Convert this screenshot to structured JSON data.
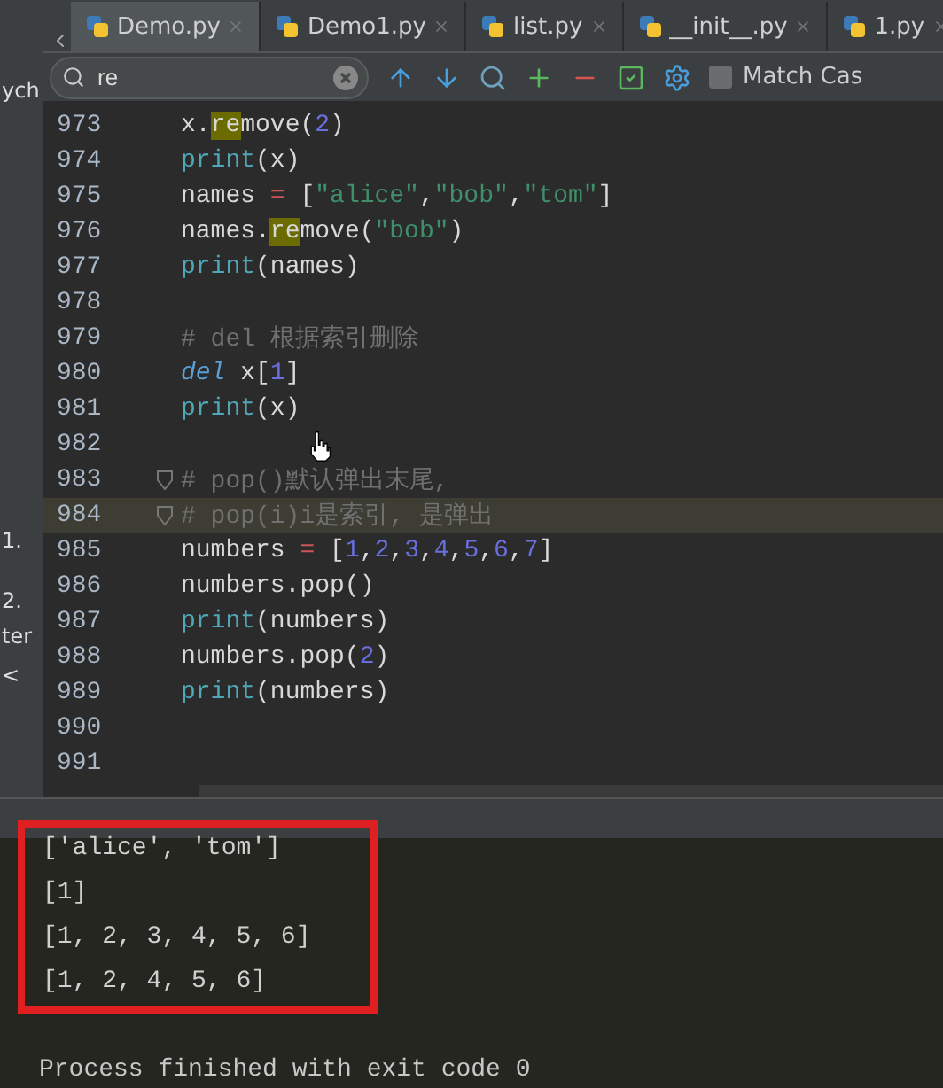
{
  "tabs": [
    {
      "label": "Demo.py",
      "selected": true
    },
    {
      "label": "Demo1.py",
      "selected": false
    },
    {
      "label": "list.py",
      "selected": false
    },
    {
      "label": "__init__.py",
      "selected": false
    },
    {
      "label": "1.py",
      "selected": false
    }
  ],
  "sidebar": {
    "fragments": [
      "ych",
      "1.",
      "2.",
      "ter",
      "<"
    ]
  },
  "search": {
    "value": "re",
    "match_case": {
      "label": "Match Cas",
      "checked": false
    }
  },
  "editor": {
    "lines": [
      {
        "number": "973",
        "current": false,
        "tokens": [
          {
            "kind": "plain",
            "text": "x."
          },
          {
            "kind": "match",
            "text": "re"
          },
          {
            "kind": "plain",
            "text": "move("
          },
          {
            "kind": "number",
            "text": "2"
          },
          {
            "kind": "plain",
            "text": ")"
          }
        ]
      },
      {
        "number": "974",
        "current": false,
        "tokens": [
          {
            "kind": "builtin",
            "text": "print"
          },
          {
            "kind": "plain",
            "text": "(x)"
          }
        ]
      },
      {
        "number": "975",
        "current": false,
        "tokens": [
          {
            "kind": "plain",
            "text": "names "
          },
          {
            "kind": "op",
            "text": "="
          },
          {
            "kind": "plain",
            "text": " ["
          },
          {
            "kind": "string",
            "text": "\"alice\""
          },
          {
            "kind": "plain",
            "text": ","
          },
          {
            "kind": "string",
            "text": "\"bob\""
          },
          {
            "kind": "plain",
            "text": ","
          },
          {
            "kind": "string",
            "text": "\"tom\""
          },
          {
            "kind": "plain",
            "text": "]"
          }
        ]
      },
      {
        "number": "976",
        "current": false,
        "tokens": [
          {
            "kind": "plain",
            "text": "names."
          },
          {
            "kind": "match",
            "text": "re"
          },
          {
            "kind": "plain",
            "text": "move("
          },
          {
            "kind": "string",
            "text": "\"bob\""
          },
          {
            "kind": "plain",
            "text": ")"
          }
        ]
      },
      {
        "number": "977",
        "current": false,
        "tokens": [
          {
            "kind": "builtin",
            "text": "print"
          },
          {
            "kind": "plain",
            "text": "(names)"
          }
        ]
      },
      {
        "number": "978",
        "current": false
      },
      {
        "number": "979",
        "current": false,
        "tokens": [
          {
            "kind": "comment",
            "text": "# del 根据索引删除"
          }
        ]
      },
      {
        "number": "980",
        "current": false,
        "tokens": [
          {
            "kind": "keyword",
            "text": "del"
          },
          {
            "kind": "plain",
            "text": " x["
          },
          {
            "kind": "number",
            "text": "1"
          },
          {
            "kind": "plain",
            "text": "]"
          }
        ]
      },
      {
        "number": "981",
        "current": false,
        "tokens": [
          {
            "kind": "builtin",
            "text": "print"
          },
          {
            "kind": "plain",
            "text": "(x)"
          }
        ]
      },
      {
        "number": "982",
        "current": false
      },
      {
        "number": "983",
        "current": false,
        "fold": true,
        "tokens": [
          {
            "kind": "comment",
            "text": "# pop()默认弹出末尾,"
          }
        ]
      },
      {
        "number": "984",
        "current": true,
        "fold": true,
        "tokens": [
          {
            "kind": "comment",
            "text": "# pop(i)i是索引, 是弹出"
          }
        ]
      },
      {
        "number": "985",
        "current": false,
        "tokens": [
          {
            "kind": "plain",
            "text": "numbers "
          },
          {
            "kind": "op",
            "text": "="
          },
          {
            "kind": "plain",
            "text": " ["
          },
          {
            "kind": "number",
            "text": "1"
          },
          {
            "kind": "plain",
            "text": ","
          },
          {
            "kind": "number",
            "text": "2"
          },
          {
            "kind": "plain",
            "text": ","
          },
          {
            "kind": "number",
            "text": "3"
          },
          {
            "kind": "plain",
            "text": ","
          },
          {
            "kind": "number",
            "text": "4"
          },
          {
            "kind": "plain",
            "text": ","
          },
          {
            "kind": "number",
            "text": "5"
          },
          {
            "kind": "plain",
            "text": ","
          },
          {
            "kind": "number",
            "text": "6"
          },
          {
            "kind": "plain",
            "text": ","
          },
          {
            "kind": "number",
            "text": "7"
          },
          {
            "kind": "plain",
            "text": "]"
          }
        ]
      },
      {
        "number": "986",
        "current": false,
        "tokens": [
          {
            "kind": "plain",
            "text": "numbers.pop()"
          }
        ]
      },
      {
        "number": "987",
        "current": false,
        "tokens": [
          {
            "kind": "builtin",
            "text": "print"
          },
          {
            "kind": "plain",
            "text": "(numbers)"
          }
        ]
      },
      {
        "number": "988",
        "current": false,
        "tokens": [
          {
            "kind": "plain",
            "text": "numbers.pop("
          },
          {
            "kind": "number",
            "text": "2"
          },
          {
            "kind": "plain",
            "text": ")"
          }
        ]
      },
      {
        "number": "989",
        "current": false,
        "tokens": [
          {
            "kind": "builtin",
            "text": "print"
          },
          {
            "kind": "plain",
            "text": "(numbers)"
          }
        ]
      },
      {
        "number": "990",
        "current": false
      },
      {
        "number": "991",
        "current": false
      }
    ]
  },
  "console": {
    "lines": [
      "['alice', 'tom']",
      "[1]",
      "[1, 2, 3, 4, 5, 6]",
      "[1, 2, 4, 5, 6]"
    ],
    "status": "Process finished with exit code 0"
  }
}
